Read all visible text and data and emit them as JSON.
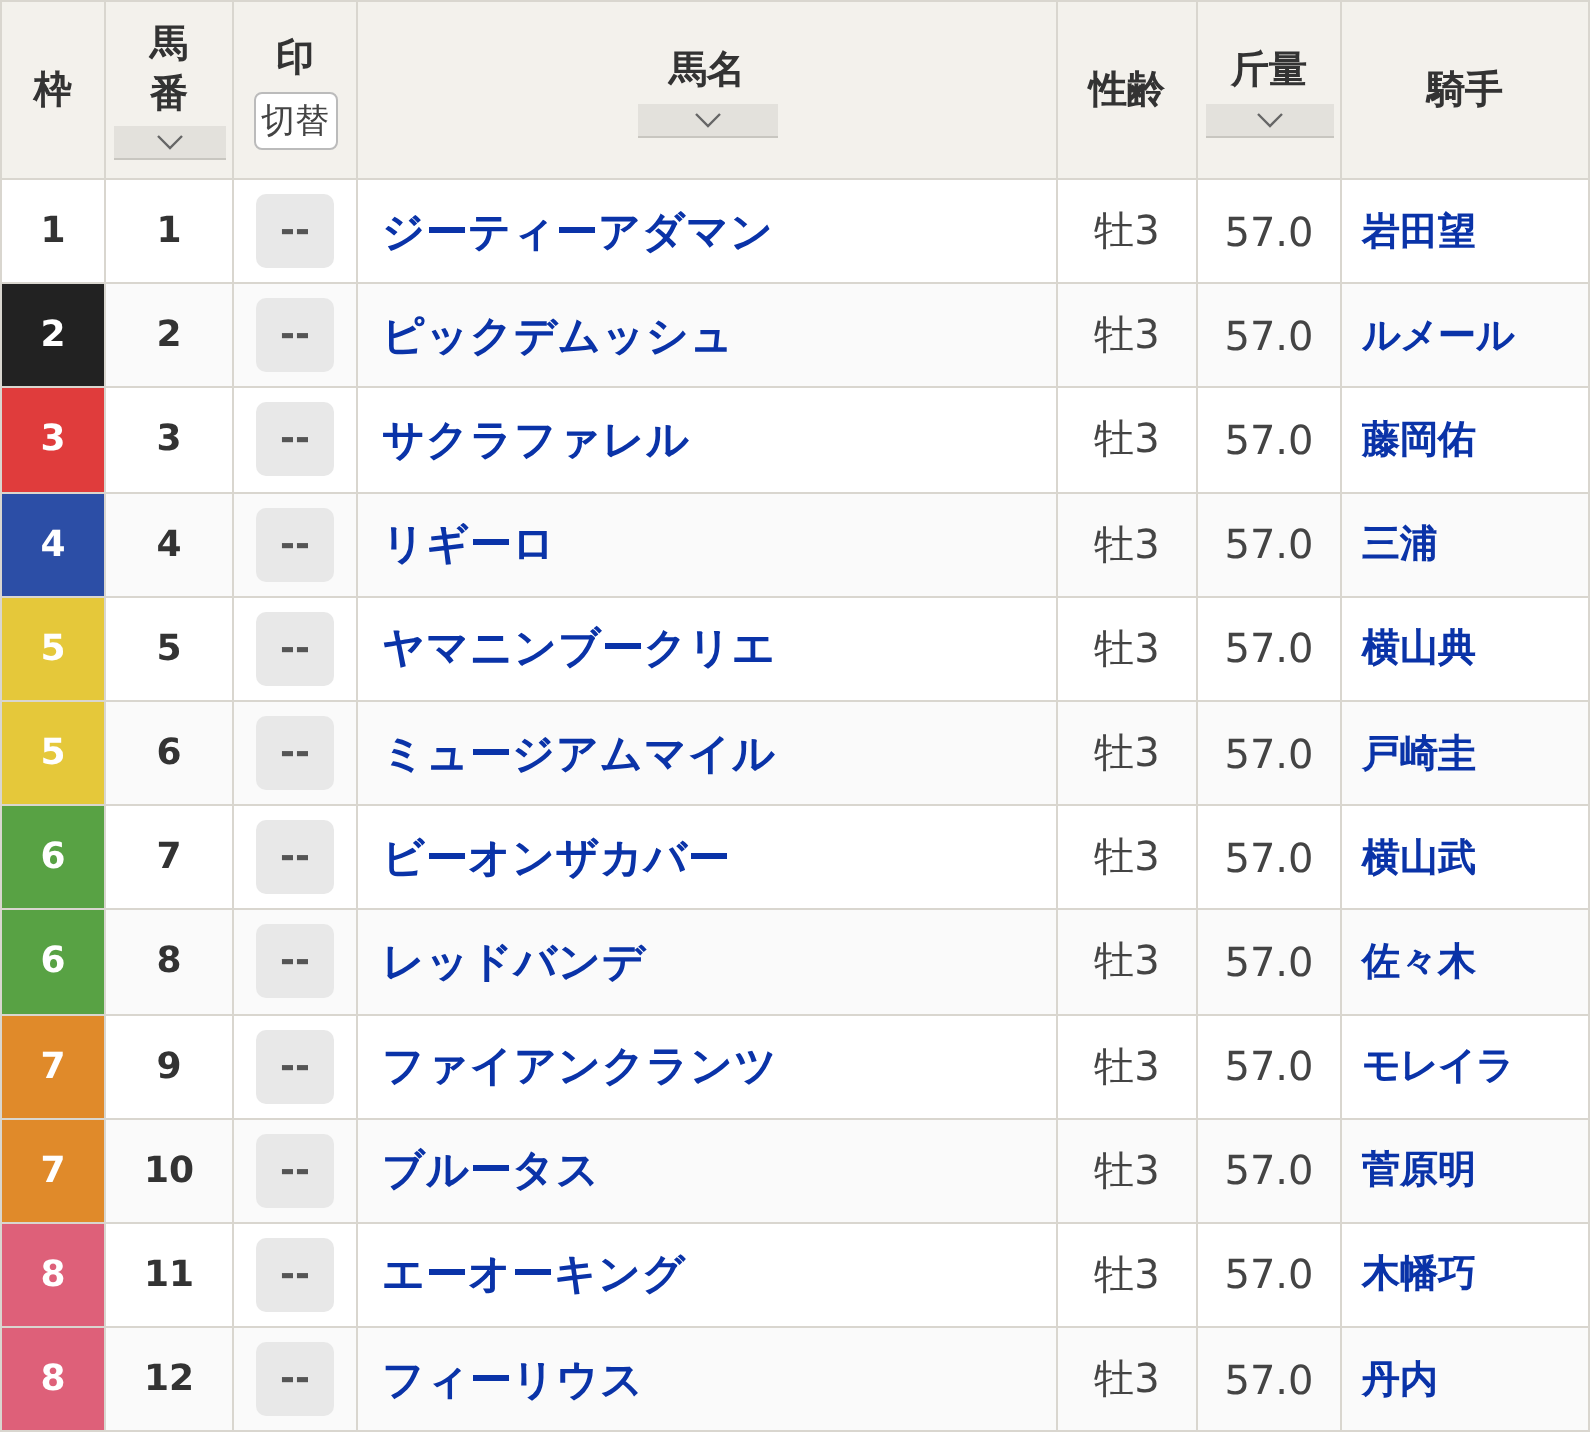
{
  "columns": [
    {
      "label": "枠",
      "kind": "plain"
    },
    {
      "label": "馬番",
      "kind": "sort"
    },
    {
      "label": "印",
      "kind": "toggle",
      "button": "切替"
    },
    {
      "label": "馬名",
      "kind": "sort"
    },
    {
      "label": "性齢",
      "kind": "plain"
    },
    {
      "label": "斤量",
      "kind": "sort"
    },
    {
      "label": "騎手",
      "kind": "plain"
    }
  ],
  "rows": [
    {
      "frame": "1",
      "color": "#ffffff",
      "number": "1",
      "mark": "--",
      "horse": "ジーティーアダマン",
      "sex_age": "牡3",
      "weight": "57.0",
      "jockey": "岩田望"
    },
    {
      "frame": "2",
      "color": "#222222",
      "number": "2",
      "mark": "--",
      "horse": "ピックデムッシュ",
      "sex_age": "牡3",
      "weight": "57.0",
      "jockey": "ルメール"
    },
    {
      "frame": "3",
      "color": "#e03c3c",
      "number": "3",
      "mark": "--",
      "horse": "サクラファレル",
      "sex_age": "牡3",
      "weight": "57.0",
      "jockey": "藤岡佑"
    },
    {
      "frame": "4",
      "color": "#2c4ea6",
      "number": "4",
      "mark": "--",
      "horse": "リギーロ",
      "sex_age": "牡3",
      "weight": "57.0",
      "jockey": "三浦"
    },
    {
      "frame": "5",
      "color": "#e5c83a",
      "number": "5",
      "mark": "--",
      "horse": "ヤマニンブークリエ",
      "sex_age": "牡3",
      "weight": "57.0",
      "jockey": "横山典"
    },
    {
      "frame": "5",
      "color": "#e5c83a",
      "number": "6",
      "mark": "--",
      "horse": "ミュージアムマイル",
      "sex_age": "牡3",
      "weight": "57.0",
      "jockey": "戸崎圭"
    },
    {
      "frame": "6",
      "color": "#58a244",
      "number": "7",
      "mark": "--",
      "horse": "ビーオンザカバー",
      "sex_age": "牡3",
      "weight": "57.0",
      "jockey": "横山武"
    },
    {
      "frame": "6",
      "color": "#58a244",
      "number": "8",
      "mark": "--",
      "horse": "レッドバンデ",
      "sex_age": "牡3",
      "weight": "57.0",
      "jockey": "佐々木"
    },
    {
      "frame": "7",
      "color": "#e08a2a",
      "number": "9",
      "mark": "--",
      "horse": "ファイアンクランツ",
      "sex_age": "牡3",
      "weight": "57.0",
      "jockey": "モレイラ"
    },
    {
      "frame": "7",
      "color": "#e08a2a",
      "number": "10",
      "mark": "--",
      "horse": "ブルータス",
      "sex_age": "牡3",
      "weight": "57.0",
      "jockey": "菅原明"
    },
    {
      "frame": "8",
      "color": "#de6079",
      "number": "11",
      "mark": "--",
      "horse": "エーオーキング",
      "sex_age": "牡3",
      "weight": "57.0",
      "jockey": "木幡巧"
    },
    {
      "frame": "8",
      "color": "#de6079",
      "number": "12",
      "mark": "--",
      "horse": "フィーリウス",
      "sex_age": "牡3",
      "weight": "57.0",
      "jockey": "丹内"
    }
  ]
}
